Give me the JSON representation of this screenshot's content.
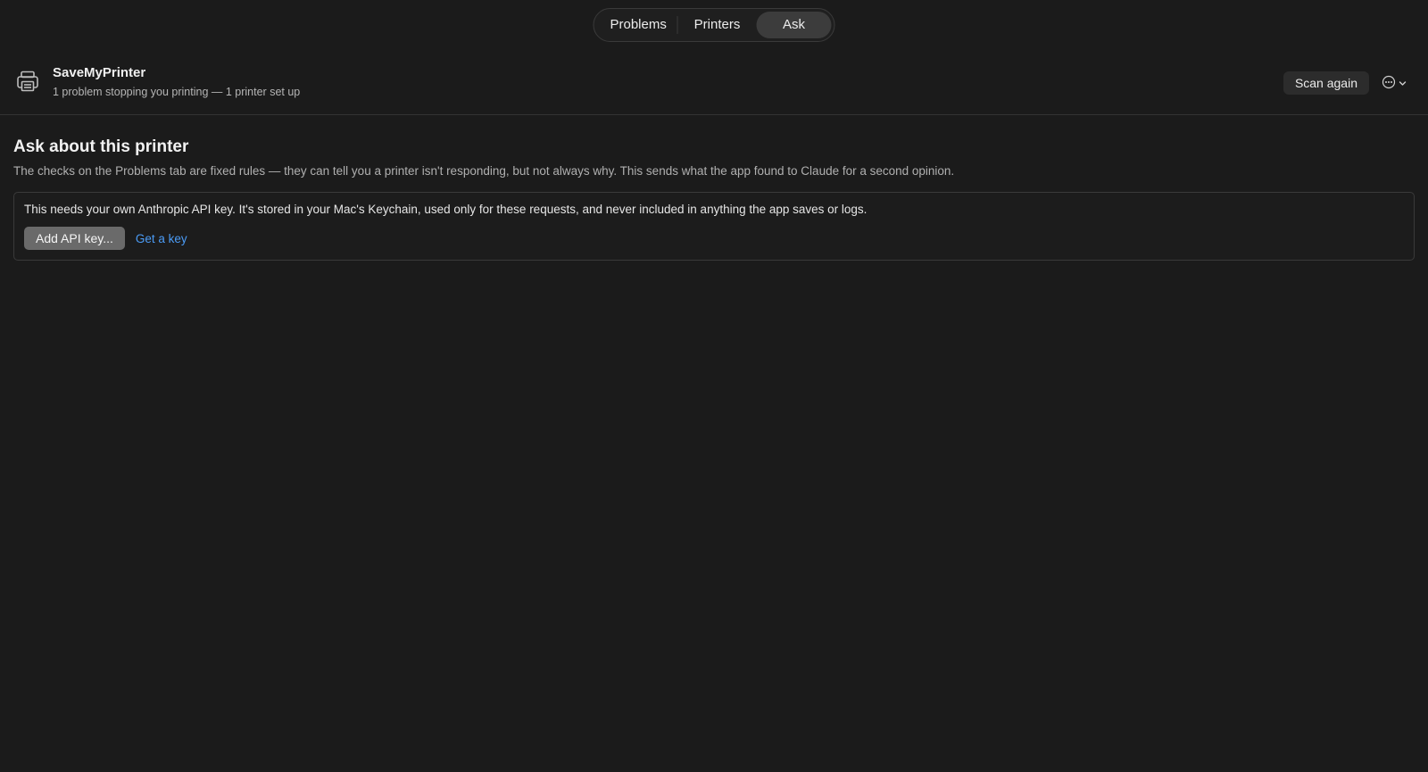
{
  "tabs": [
    {
      "label": "Problems",
      "selected": false
    },
    {
      "label": "Printers",
      "selected": false
    },
    {
      "label": "Ask",
      "selected": true
    }
  ],
  "header": {
    "app_name": "SaveMyPrinter",
    "status": "1 problem stopping you printing — 1 printer set up",
    "scan_button": "Scan again",
    "more_icon": "ellipsis-circle-icon"
  },
  "main": {
    "title": "Ask about this printer",
    "description": "The checks on the Problems tab are fixed rules — they can tell you a printer isn't responding, but not always why. This sends what the app found to Claude for a second opinion.",
    "panel": {
      "text": "This needs your own Anthropic API key. It's stored in your Mac's Keychain, used only for these requests, and never included in anything the app saves or logs.",
      "add_key_button": "Add API key...",
      "get_key_link": "Get a key"
    }
  },
  "colors": {
    "background": "#1b1b1b",
    "accent_link": "#4b9bf5",
    "selected_tab": "#3c3c3c"
  }
}
